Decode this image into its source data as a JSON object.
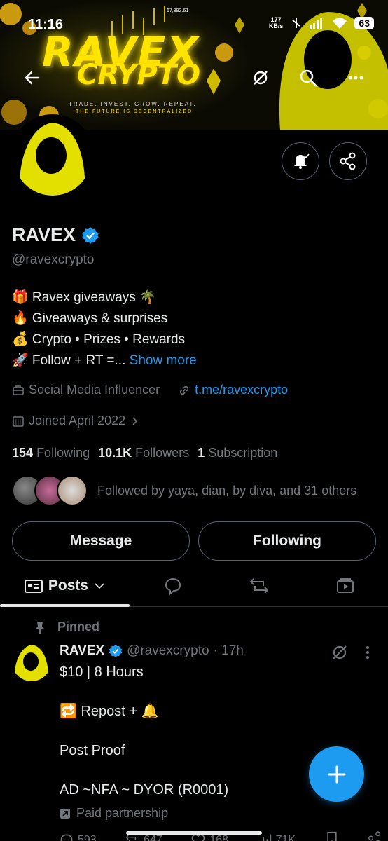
{
  "status_bar": {
    "time": "11:16",
    "speed_value": "177",
    "speed_unit": "KB/s",
    "battery": "63"
  },
  "banner": {
    "title": "RAVEX",
    "subtitle": "CRYPTO",
    "tagline": "TRADE. INVEST. GROW. REPEAT.",
    "tagline2": "THE FUTURE IS DECENTRALIZED",
    "price": "67,892.61"
  },
  "profile": {
    "name": "RAVEX",
    "handle": "@ravexcrypto",
    "bio": [
      "🎁 Ravex giveaways 🌴",
      "🔥 Giveaways & surprises",
      "💰 Crypto • Prizes • Rewards",
      "🚀 Follow + RT =..."
    ],
    "show_more": "Show more",
    "category": "Social Media Influencer",
    "link": "t.me/ravexcrypto",
    "joined": "Joined April 2022",
    "following_count": "154",
    "following_label": "Following",
    "followers_count": "10.1K",
    "followers_label": "Followers",
    "subscription_count": "1",
    "subscription_label": "Subscription",
    "followed_by": "Followed by yaya, dian, by diva, and 31 others"
  },
  "buttons": {
    "message": "Message",
    "following": "Following"
  },
  "tabs": {
    "posts": "Posts"
  },
  "post": {
    "pinned_label": "Pinned",
    "name": "RAVEX",
    "handle": "@ravexcrypto",
    "time": "· 17h",
    "lines": [
      "$10 |  8 Hours",
      "",
      "🔁 Repost + 🔔",
      "",
      "Post Proof",
      "",
      "AD ~NFA ~ DYOR (R0001)"
    ],
    "paid": "Paid partnership",
    "replies": "593",
    "reposts": "647",
    "likes": "168",
    "views": "71K"
  },
  "colors": {
    "accent": "#1d9bf0",
    "brand_yellow": "#ffe400",
    "muted": "#71767b",
    "text": "#e7e9ea"
  }
}
